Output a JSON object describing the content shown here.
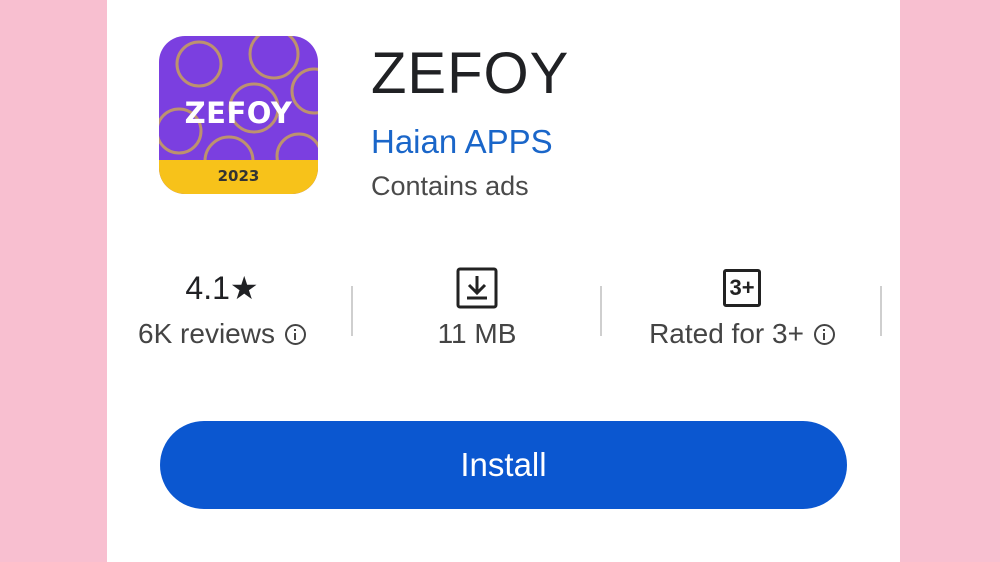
{
  "app": {
    "name": "ZEFOY",
    "developer": "Haian APPS",
    "ads_notice": "Contains ads",
    "icon": {
      "title": "ZEFOY",
      "year": "2023",
      "background_color": "#7b3fe0",
      "band_color": "#f7c21a"
    }
  },
  "stats": {
    "rating": {
      "value": "4.1★",
      "label": "6K reviews",
      "info_icon": "info-icon"
    },
    "size": {
      "icon": "download-icon",
      "label": "11 MB"
    },
    "content_rating": {
      "badge": "3+",
      "label": "Rated for 3+",
      "info_icon": "info-icon"
    }
  },
  "actions": {
    "install_label": "Install",
    "install_color": "#0b57d0"
  },
  "colors": {
    "page_background": "#f8bfd0",
    "developer_link": "#1a66c9"
  }
}
